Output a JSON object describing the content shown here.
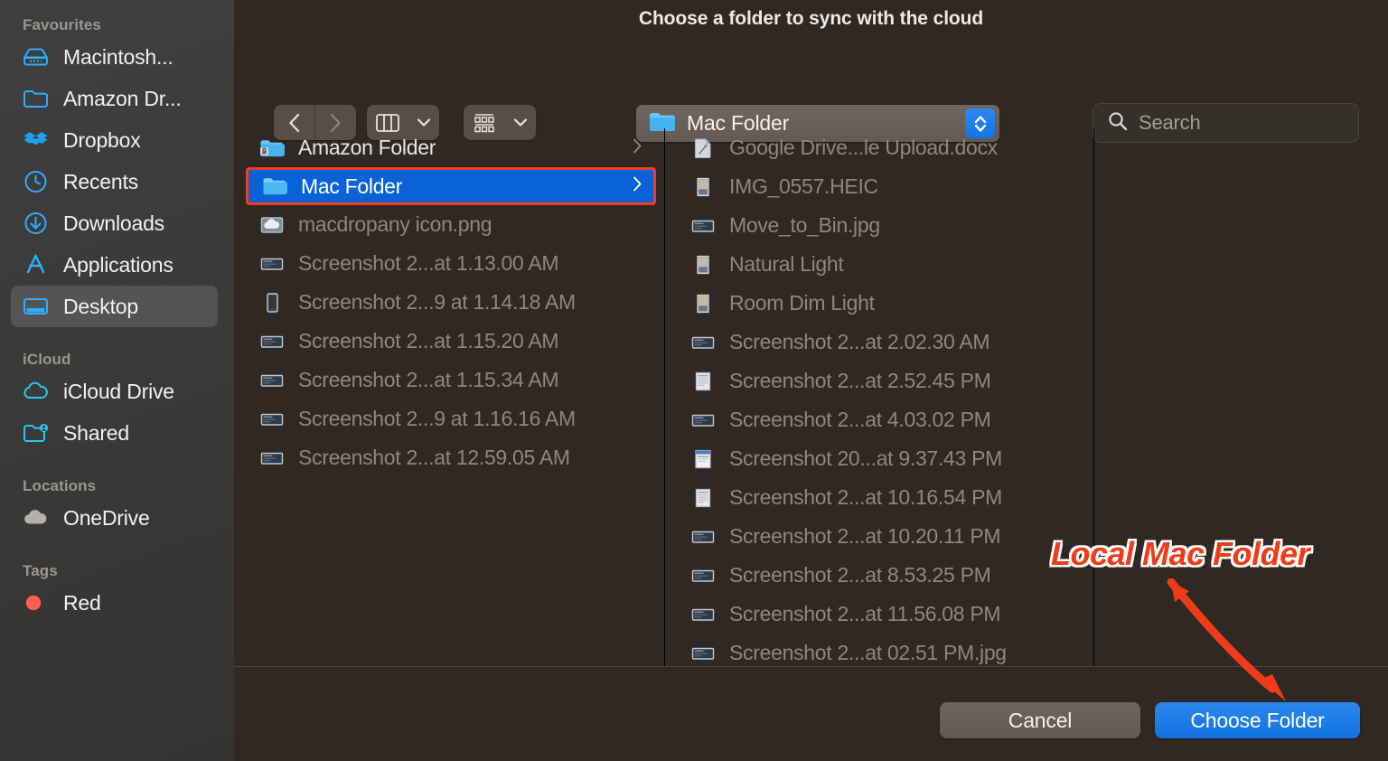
{
  "sidebar": {
    "groups": [
      {
        "title": "Favourites",
        "items": [
          {
            "label": "Macintosh...",
            "icon": "hard-drive-icon",
            "selected": false
          },
          {
            "label": "Amazon Dr...",
            "icon": "folder-icon",
            "selected": false
          },
          {
            "label": "Dropbox",
            "icon": "dropbox-icon",
            "selected": false
          },
          {
            "label": "Recents",
            "icon": "clock-icon",
            "selected": false
          },
          {
            "label": "Downloads",
            "icon": "download-icon",
            "selected": false
          },
          {
            "label": "Applications",
            "icon": "applications-icon",
            "selected": false
          },
          {
            "label": "Desktop",
            "icon": "desktop-icon",
            "selected": true
          }
        ]
      },
      {
        "title": "iCloud",
        "items": [
          {
            "label": "iCloud Drive",
            "icon": "cloud-icon",
            "selected": false
          },
          {
            "label": "Shared",
            "icon": "shared-folder-icon",
            "selected": false
          }
        ]
      },
      {
        "title": "Locations",
        "items": [
          {
            "label": "OneDrive",
            "icon": "onedrive-cloud-icon",
            "selected": false
          }
        ]
      },
      {
        "title": "Tags",
        "items": [
          {
            "label": "Red",
            "icon": "red-tag-dot-icon",
            "selected": false
          }
        ]
      }
    ]
  },
  "dialog": {
    "title": "Choose a folder to sync with the cloud",
    "toolbar": {
      "back": "back-button",
      "forward": "forward-button",
      "view_mode": "column-view",
      "group_mode": "group-by",
      "path_label": "Mac Folder",
      "search_placeholder": "Search"
    },
    "columns": [
      {
        "name": "column-one",
        "rows": [
          {
            "name": "Amazon Folder",
            "icon": "locked-folder-icon",
            "kind": "folder",
            "selected": false,
            "disclosure": true,
            "bright": true
          },
          {
            "name": "Mac Folder",
            "icon": "folder-icon",
            "kind": "folder",
            "selected": true,
            "disclosure": true,
            "bright": true
          },
          {
            "name": "macdropany icon.png",
            "icon": "image-cloud-icon",
            "kind": "file",
            "selected": false,
            "disclosure": false,
            "bright": false
          },
          {
            "name": "Screenshot 2...at 1.13.00 AM",
            "icon": "screenshot-thumb-icon",
            "kind": "file",
            "selected": false,
            "disclosure": false,
            "bright": false
          },
          {
            "name": "Screenshot 2...9 at 1.14.18 AM",
            "icon": "phone-thumb-icon",
            "kind": "file",
            "selected": false,
            "disclosure": false,
            "bright": false
          },
          {
            "name": "Screenshot 2...at 1.15.20 AM",
            "icon": "screenshot-thumb-icon",
            "kind": "file",
            "selected": false,
            "disclosure": false,
            "bright": false
          },
          {
            "name": "Screenshot 2...at 1.15.34 AM",
            "icon": "screenshot-thumb-icon",
            "kind": "file",
            "selected": false,
            "disclosure": false,
            "bright": false
          },
          {
            "name": "Screenshot 2...9 at 1.16.16 AM",
            "icon": "screenshot-thumb-icon",
            "kind": "file",
            "selected": false,
            "disclosure": false,
            "bright": false
          },
          {
            "name": "Screenshot 2...at 12.59.05 AM",
            "icon": "screenshot-thumb-icon",
            "kind": "file",
            "selected": false,
            "disclosure": false,
            "bright": false
          }
        ]
      },
      {
        "name": "column-two",
        "rows": [
          {
            "name": "Google Drive...le Upload.docx",
            "icon": "document-icon",
            "kind": "file",
            "selected": false,
            "disclosure": false,
            "bright": false
          },
          {
            "name": "IMG_0557.HEIC",
            "icon": "photo-thumb-icon",
            "kind": "file",
            "selected": false,
            "disclosure": false,
            "bright": false
          },
          {
            "name": "Move_to_Bin.jpg",
            "icon": "screenshot-thumb-icon",
            "kind": "file",
            "selected": false,
            "disclosure": false,
            "bright": false
          },
          {
            "name": "Natural Light",
            "icon": "photo-thumb-icon",
            "kind": "file",
            "selected": false,
            "disclosure": false,
            "bright": false
          },
          {
            "name": "Room Dim Light",
            "icon": "photo-thumb-icon",
            "kind": "file",
            "selected": false,
            "disclosure": false,
            "bright": false
          },
          {
            "name": "Screenshot 2...at 2.02.30 AM",
            "icon": "screenshot-thumb-icon",
            "kind": "file",
            "selected": false,
            "disclosure": false,
            "bright": false
          },
          {
            "name": "Screenshot 2...at 2.52.45 PM",
            "icon": "document-thumb-icon",
            "kind": "file",
            "selected": false,
            "disclosure": false,
            "bright": false
          },
          {
            "name": "Screenshot 2...at 4.03.02 PM",
            "icon": "screenshot-thumb-icon",
            "kind": "file",
            "selected": false,
            "disclosure": false,
            "bright": false
          },
          {
            "name": "Screenshot 20...at 9.37.43 PM",
            "icon": "window-thumb-icon",
            "kind": "file",
            "selected": false,
            "disclosure": false,
            "bright": false
          },
          {
            "name": "Screenshot 2...at 10.16.54 PM",
            "icon": "document-thumb-icon",
            "kind": "file",
            "selected": false,
            "disclosure": false,
            "bright": false
          },
          {
            "name": "Screenshot 2...at 10.20.11 PM",
            "icon": "screenshot-thumb-icon",
            "kind": "file",
            "selected": false,
            "disclosure": false,
            "bright": false
          },
          {
            "name": "Screenshot 2...at 8.53.25 PM",
            "icon": "screenshot-thumb-icon",
            "kind": "file",
            "selected": false,
            "disclosure": false,
            "bright": false
          },
          {
            "name": "Screenshot 2...at 11.56.08 PM",
            "icon": "screenshot-thumb-icon",
            "kind": "file",
            "selected": false,
            "disclosure": false,
            "bright": false
          },
          {
            "name": "Screenshot 2...at 02.51 PM.jpg",
            "icon": "screenshot-thumb-icon",
            "kind": "file",
            "selected": false,
            "disclosure": false,
            "bright": false
          }
        ]
      },
      {
        "name": "column-three",
        "rows": []
      }
    ],
    "buttons": {
      "cancel": "Cancel",
      "choose": "Choose Folder"
    }
  },
  "annotation": {
    "text": "Local Mac Folder",
    "color": "#ef3b18",
    "outline": "#ffffff"
  },
  "colors": {
    "accent_blue": "#0a63d6",
    "highlight_red": "#f23d22",
    "window_bg": "#302823",
    "sidebar_bg": "#3a3a39"
  }
}
